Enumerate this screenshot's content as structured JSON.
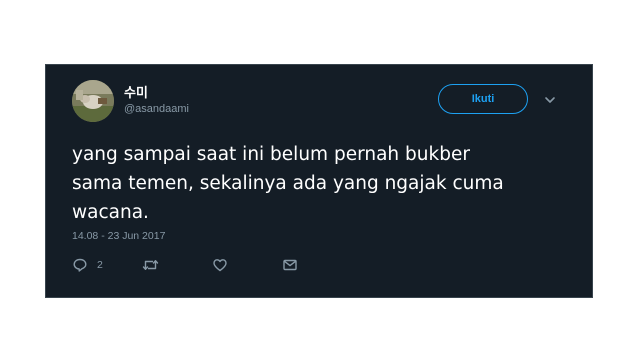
{
  "tweet": {
    "author": {
      "display_name": "수미",
      "username": "@asandaami",
      "avatar": "profile-photo"
    },
    "follow_label": "Ikuti",
    "text_lines": [
      "yang sampai saat ini belum pernah bukber",
      "sama temen, sekalinya ada yang ngajak cuma",
      "wacana."
    ],
    "timestamp": "14.08 - 23 Jun 2017",
    "actions": {
      "reply_icon": "reply-icon",
      "reply_count": "2",
      "retweet_icon": "retweet-icon",
      "like_icon": "heart-icon",
      "dm_icon": "envelope-icon"
    }
  },
  "colors": {
    "card_background": "#141d26",
    "accent": "#1da1f2",
    "muted_text": "#8899a6",
    "primary_text": "#ffffff"
  }
}
